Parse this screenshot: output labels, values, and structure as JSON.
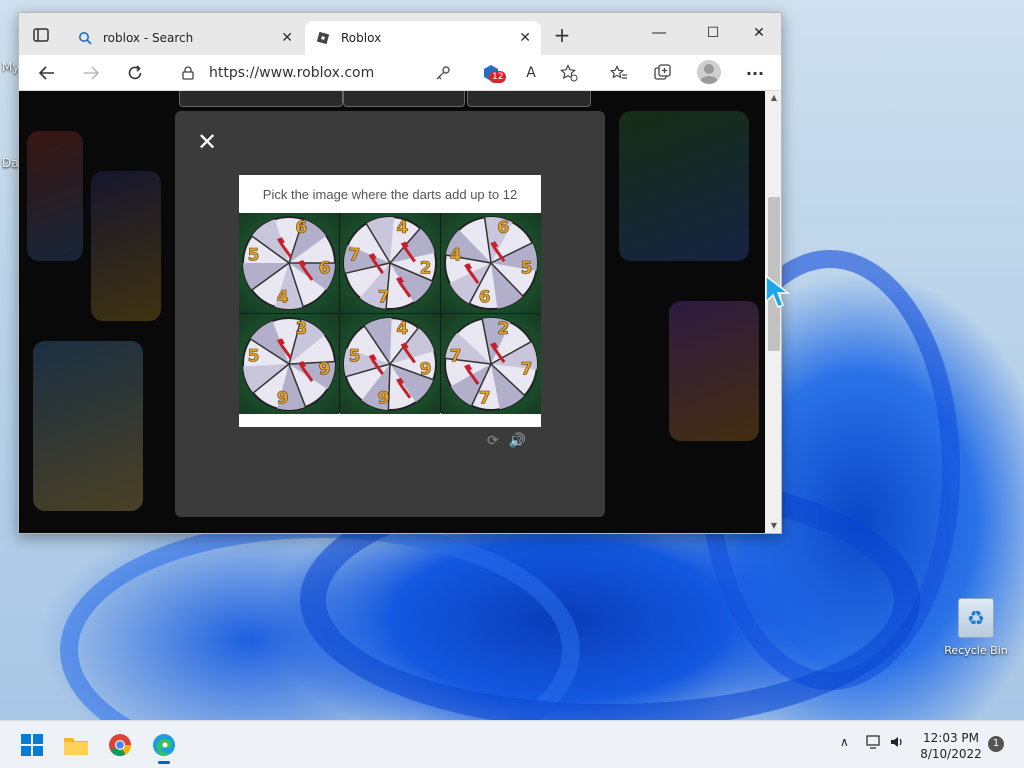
{
  "browser": {
    "tabs": [
      {
        "label": "roblox - Search",
        "icon": "search-icon",
        "active": false
      },
      {
        "label": "Roblox",
        "icon": "roblox-logo-icon",
        "active": true
      }
    ],
    "new_tab_label": "+",
    "address": "https://www.roblox.com",
    "badge_count": "12",
    "page_dropdowns": [
      "",
      "",
      ""
    ]
  },
  "captcha": {
    "prompt": "Pick the image where the darts add up to 12",
    "tiles": [
      {
        "numbers": [
          "6",
          "5",
          "6",
          "4"
        ]
      },
      {
        "numbers": [
          "4",
          "7",
          "2",
          "7"
        ]
      },
      {
        "numbers": [
          "6",
          "4",
          "5",
          "6"
        ]
      },
      {
        "numbers": [
          "3",
          "5",
          "9",
          "9"
        ]
      },
      {
        "numbers": [
          "4",
          "5",
          "9",
          "9"
        ]
      },
      {
        "numbers": [
          "2",
          "7",
          "7",
          "7"
        ]
      }
    ],
    "refresh_icon": "refresh-icon",
    "audio_icon": "speaker-icon"
  },
  "desktop": {
    "recycle_bin_label": "Recycle Bin",
    "left_label_1": "My",
    "left_label_2": "Da"
  },
  "taskbar": {
    "time": "12:03 PM",
    "date": "8/10/2022",
    "notification_count": "1"
  },
  "colors": {
    "accent": "#0067c0",
    "modal_bg": "#3b3b3b",
    "dart_red": "#c8202a",
    "number_gold": "#e8a52c"
  }
}
